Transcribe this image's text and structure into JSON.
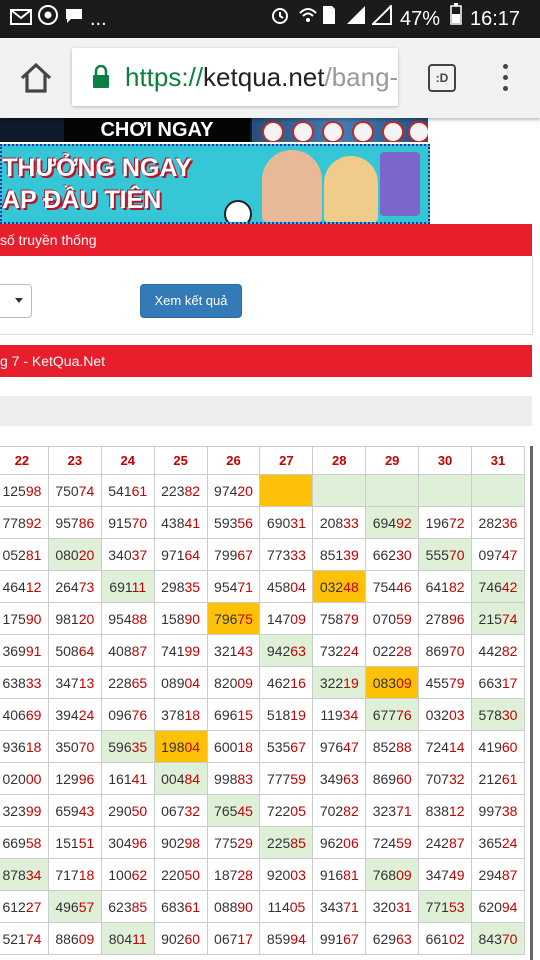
{
  "status_bar": {
    "dots": "...",
    "battery": "47%",
    "time": "16:17"
  },
  "browser": {
    "url_scheme": "https://",
    "url_host": "ketqua.net",
    "url_path": "/bang-",
    "tabs_label": ":D"
  },
  "banners": {
    "top_text": "CHƠI NGAY",
    "line1": "THƯỞNG NGAY",
    "line2": "AP ĐẦU TIÊN"
  },
  "panel1": {
    "title": "số truyền thống"
  },
  "form": {
    "submit_label": "Xem kết quả"
  },
  "panel2": {
    "title": "g 7 - KetQua.Net"
  },
  "table": {
    "columns": [
      "22",
      "23",
      "24",
      "25",
      "26",
      "27",
      "28",
      "29",
      "30",
      "31"
    ],
    "rows": [
      [
        [
          "125",
          "98"
        ],
        [
          "750",
          "74"
        ],
        [
          "541",
          "61"
        ],
        [
          "223",
          "82"
        ],
        [
          "974",
          "20"
        ],
        [
          "",
          ""
        ],
        [
          "",
          ""
        ],
        [
          "",
          ""
        ],
        [
          "",
          ""
        ],
        [
          "",
          ""
        ]
      ],
      [
        [
          "778",
          "92"
        ],
        [
          "957",
          "86"
        ],
        [
          "915",
          "70"
        ],
        [
          "438",
          "41"
        ],
        [
          "593",
          "56"
        ],
        [
          "690",
          "31"
        ],
        [
          "208",
          "33"
        ],
        [
          "694",
          "92"
        ],
        [
          "196",
          "72"
        ],
        [
          "282",
          "36"
        ]
      ],
      [
        [
          "052",
          "81"
        ],
        [
          "080",
          "20"
        ],
        [
          "340",
          "37"
        ],
        [
          "971",
          "64"
        ],
        [
          "799",
          "67"
        ],
        [
          "773",
          "33"
        ],
        [
          "851",
          "39"
        ],
        [
          "662",
          "30"
        ],
        [
          "555",
          "70"
        ],
        [
          "097",
          "47"
        ]
      ],
      [
        [
          "464",
          "12"
        ],
        [
          "264",
          "73"
        ],
        [
          "691",
          "11"
        ],
        [
          "298",
          "35"
        ],
        [
          "954",
          "71"
        ],
        [
          "458",
          "04"
        ],
        [
          "032",
          "48"
        ],
        [
          "754",
          "46"
        ],
        [
          "641",
          "82"
        ],
        [
          "746",
          "42"
        ]
      ],
      [
        [
          "175",
          "90"
        ],
        [
          "981",
          "20"
        ],
        [
          "954",
          "88"
        ],
        [
          "158",
          "90"
        ],
        [
          "796",
          "75"
        ],
        [
          "147",
          "09"
        ],
        [
          "758",
          "79"
        ],
        [
          "070",
          "59"
        ],
        [
          "278",
          "96"
        ],
        [
          "215",
          "74"
        ]
      ],
      [
        [
          "369",
          "91"
        ],
        [
          "508",
          "64"
        ],
        [
          "408",
          "87"
        ],
        [
          "741",
          "99"
        ],
        [
          "321",
          "43"
        ],
        [
          "942",
          "63"
        ],
        [
          "732",
          "24"
        ],
        [
          "022",
          "28"
        ],
        [
          "869",
          "70"
        ],
        [
          "442",
          "82"
        ]
      ],
      [
        [
          "638",
          "33"
        ],
        [
          "347",
          "13"
        ],
        [
          "228",
          "65"
        ],
        [
          "089",
          "04"
        ],
        [
          "820",
          "09"
        ],
        [
          "462",
          "16"
        ],
        [
          "322",
          "19"
        ],
        [
          "083",
          "09"
        ],
        [
          "455",
          "79"
        ],
        [
          "663",
          "17"
        ]
      ],
      [
        [
          "406",
          "69"
        ],
        [
          "394",
          "24"
        ],
        [
          "096",
          "76"
        ],
        [
          "378",
          "18"
        ],
        [
          "696",
          "15"
        ],
        [
          "518",
          "19"
        ],
        [
          "119",
          "34"
        ],
        [
          "677",
          "76"
        ],
        [
          "032",
          "03"
        ],
        [
          "578",
          "30"
        ]
      ],
      [
        [
          "936",
          "18"
        ],
        [
          "350",
          "70"
        ],
        [
          "596",
          "35"
        ],
        [
          "198",
          "04"
        ],
        [
          "600",
          "18"
        ],
        [
          "535",
          "67"
        ],
        [
          "976",
          "47"
        ],
        [
          "852",
          "88"
        ],
        [
          "724",
          "14"
        ],
        [
          "419",
          "60"
        ]
      ],
      [
        [
          "020",
          "00"
        ],
        [
          "129",
          "96"
        ],
        [
          "161",
          "41"
        ],
        [
          "004",
          "84"
        ],
        [
          "998",
          "83"
        ],
        [
          "777",
          "59"
        ],
        [
          "349",
          "63"
        ],
        [
          "869",
          "60"
        ],
        [
          "707",
          "32"
        ],
        [
          "212",
          "61"
        ]
      ],
      [
        [
          "323",
          "99"
        ],
        [
          "659",
          "43"
        ],
        [
          "290",
          "50"
        ],
        [
          "067",
          "32"
        ],
        [
          "765",
          "45"
        ],
        [
          "722",
          "05"
        ],
        [
          "702",
          "82"
        ],
        [
          "323",
          "71"
        ],
        [
          "838",
          "12"
        ],
        [
          "997",
          "38"
        ]
      ],
      [
        [
          "669",
          "58"
        ],
        [
          "151",
          "51"
        ],
        [
          "304",
          "96"
        ],
        [
          "902",
          "98"
        ],
        [
          "775",
          "29"
        ],
        [
          "225",
          "85"
        ],
        [
          "962",
          "06"
        ],
        [
          "724",
          "59"
        ],
        [
          "242",
          "87"
        ],
        [
          "365",
          "24"
        ]
      ],
      [
        [
          "878",
          "34"
        ],
        [
          "717",
          "18"
        ],
        [
          "100",
          "62"
        ],
        [
          "220",
          "50"
        ],
        [
          "187",
          "28"
        ],
        [
          "920",
          "03"
        ],
        [
          "916",
          "81"
        ],
        [
          "768",
          "09"
        ],
        [
          "347",
          "49"
        ],
        [
          "294",
          "87"
        ]
      ],
      [
        [
          "612",
          "27"
        ],
        [
          "496",
          "57"
        ],
        [
          "623",
          "85"
        ],
        [
          "683",
          "61"
        ],
        [
          "088",
          "90"
        ],
        [
          "114",
          "05"
        ],
        [
          "343",
          "71"
        ],
        [
          "320",
          "31"
        ],
        [
          "771",
          "53"
        ],
        [
          "620",
          "94"
        ]
      ],
      [
        [
          "521",
          "74"
        ],
        [
          "886",
          "09"
        ],
        [
          "804",
          "11"
        ],
        [
          "902",
          "60"
        ],
        [
          "067",
          "17"
        ],
        [
          "859",
          "94"
        ],
        [
          "991",
          "67"
        ],
        [
          "629",
          "63"
        ],
        [
          "661",
          "02"
        ],
        [
          "843",
          "70"
        ]
      ]
    ],
    "highlights": {
      "green": [
        "0-5",
        "0-6",
        "0-7",
        "0-8",
        "0-9",
        "1-7",
        "2-1",
        "2-8",
        "3-2",
        "3-9",
        "4-9",
        "5-5",
        "6-6",
        "7-7",
        "7-9",
        "8-2",
        "9-3",
        "10-4",
        "11-5",
        "12-0",
        "12-7",
        "13-1",
        "13-8",
        "14-2",
        "14-9"
      ],
      "orange": [
        "0-5",
        "3-6",
        "4-4",
        "6-7",
        "8-3"
      ]
    }
  }
}
